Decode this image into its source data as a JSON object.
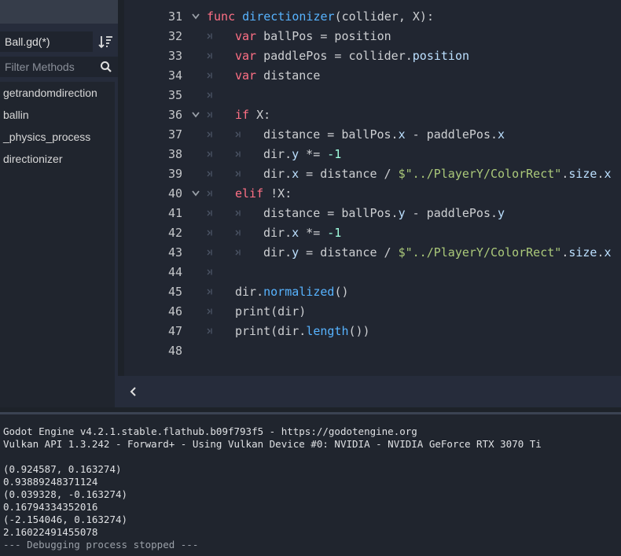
{
  "script_panel": {
    "file_label": "Ball.gd(*)",
    "filter_placeholder": "Filter Methods",
    "methods": [
      "getrandomdirection",
      "ballin",
      "_physics_process",
      "directionizer"
    ]
  },
  "editor": {
    "lines": [
      {
        "n": "31",
        "fold": true,
        "indent": 0,
        "text": "func directionizer(collider, X):"
      },
      {
        "n": "32",
        "fold": false,
        "indent": 1,
        "text": "var ballPos = position"
      },
      {
        "n": "33",
        "fold": false,
        "indent": 1,
        "text": "var paddlePos = collider.position"
      },
      {
        "n": "34",
        "fold": false,
        "indent": 1,
        "text": "var distance"
      },
      {
        "n": "35",
        "fold": false,
        "indent": 1,
        "text": ""
      },
      {
        "n": "36",
        "fold": true,
        "indent": 1,
        "text": "if X:"
      },
      {
        "n": "37",
        "fold": false,
        "indent": 2,
        "text": "distance = ballPos.x - paddlePos.x"
      },
      {
        "n": "38",
        "fold": false,
        "indent": 2,
        "text": "dir.y *= -1"
      },
      {
        "n": "39",
        "fold": false,
        "indent": 2,
        "text": "dir.x = distance / $\"../PlayerY/ColorRect\".size.x"
      },
      {
        "n": "40",
        "fold": true,
        "indent": 1,
        "text": "elif !X:"
      },
      {
        "n": "41",
        "fold": false,
        "indent": 2,
        "text": "distance = ballPos.y - paddlePos.y"
      },
      {
        "n": "42",
        "fold": false,
        "indent": 2,
        "text": "dir.x *= -1"
      },
      {
        "n": "43",
        "fold": false,
        "indent": 2,
        "text": "dir.y = distance / $\"../PlayerY/ColorRect\".size.x"
      },
      {
        "n": "44",
        "fold": false,
        "indent": 1,
        "text": ""
      },
      {
        "n": "45",
        "fold": false,
        "indent": 1,
        "text": "dir.normalized()"
      },
      {
        "n": "46",
        "fold": false,
        "indent": 1,
        "text": "print(dir)"
      },
      {
        "n": "47",
        "fold": false,
        "indent": 1,
        "text": "print(dir.length())"
      },
      {
        "n": "48",
        "fold": false,
        "indent": 0,
        "text": ""
      }
    ]
  },
  "output": {
    "lines": [
      "Godot Engine v4.2.1.stable.flathub.b09f793f5 - https://godotengine.org",
      "Vulkan API 1.3.242 - Forward+ - Using Vulkan Device #0: NVIDIA - NVIDIA GeForce RTX 3070 Ti",
      "",
      "(0.924587, 0.163274)",
      "0.93889248371124",
      "(0.039328, -0.163274)",
      "0.16794334352016",
      "(-2.154046, 0.163274)",
      "2.16022491455078",
      "--- Debugging process stopped ---"
    ]
  },
  "colors": {
    "keyword": "#ff7085",
    "function": "#57b3ff",
    "string": "#abc97a",
    "number": "#a1ffe0",
    "background": "#212631"
  },
  "icons": {
    "sort": "sort-icon",
    "search": "search-icon",
    "fold": "chevron-down-icon",
    "indent": "tab-indent-icon",
    "collapse": "chevron-left-icon"
  }
}
